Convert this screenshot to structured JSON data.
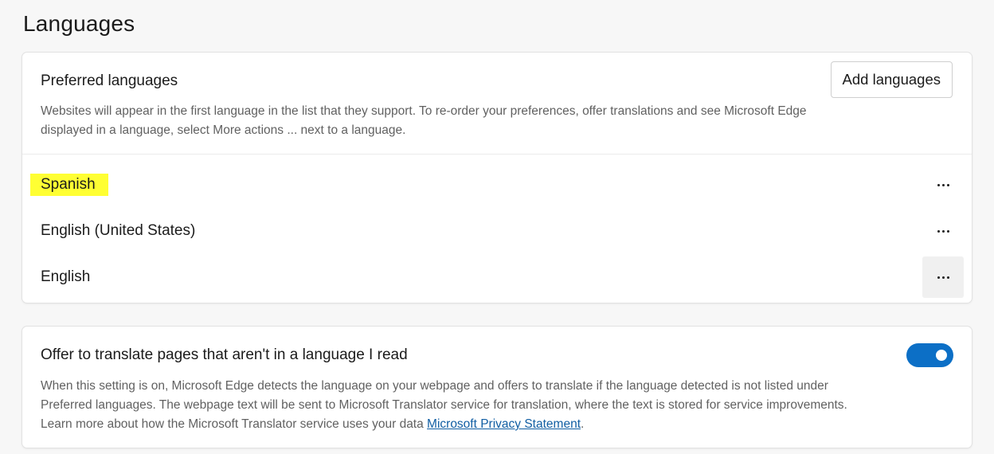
{
  "page": {
    "title": "Languages"
  },
  "preferred": {
    "heading": "Preferred languages",
    "add_button": "Add languages",
    "description_line1": "Websites will appear in the first language in the list that they support. To re-order your preferences, offer translations and see Microsoft Edge",
    "description_line2": "displayed in a language, select More actions ... next to a language.",
    "languages": [
      {
        "name": "Spanish",
        "highlighted": true,
        "more_icon": "more-horizontal-icon"
      },
      {
        "name": "English (United States)",
        "highlighted": false,
        "more_icon": "more-horizontal-icon"
      },
      {
        "name": "English",
        "highlighted": false,
        "more_icon": "more-horizontal-icon"
      }
    ]
  },
  "translate": {
    "heading": "Offer to translate pages that aren't in a language I read",
    "toggle_on": true,
    "description_line1": "When this setting is on, Microsoft Edge detects the language on your webpage and offers to translate if the language detected is not listed under",
    "description_line2": "Preferred languages. The webpage text will be sent to Microsoft Translator service for translation, where the text is stored for service improvements.",
    "description_line3": "Learn more about how the Microsoft Translator service uses your data ",
    "link_text": "Microsoft Privacy Statement",
    "trailing": "."
  },
  "colors": {
    "accent": "#0c6fc6",
    "highlight": "#ffff33",
    "link": "#115ea3"
  }
}
